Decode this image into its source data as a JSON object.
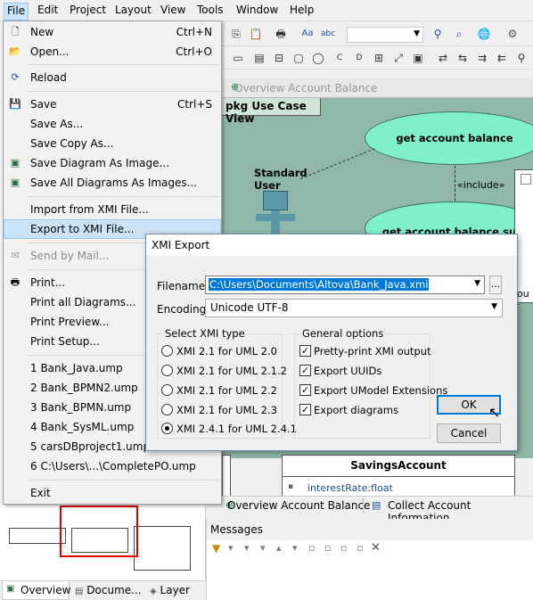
{
  "menubar": {
    "items": [
      "File",
      "Edit",
      "Project",
      "Layout",
      "View",
      "Tools",
      "Window",
      "Help"
    ]
  },
  "diagram": {
    "tab_title": "Overview Account Balance",
    "pkg_title": "pkg Use Case View",
    "actor_label_1": "Standard",
    "actor_label_2": "User",
    "usecase_1": "get account balance",
    "usecase_2": "get account balance sum",
    "include_label": "«include»",
    "savings_title": "SavingsAccount",
    "savings_attr": "interestRate:float",
    "right_fragment": "ou"
  },
  "file_menu": {
    "new": "New",
    "new_sc": "Ctrl+N",
    "open": "Open...",
    "open_sc": "Ctrl+O",
    "reload": "Reload",
    "save": "Save",
    "save_sc": "Ctrl+S",
    "save_as": "Save As...",
    "save_copy": "Save Copy As...",
    "save_diagram_image": "Save Diagram As Image...",
    "save_all_images": "Save All Diagrams As Images...",
    "import_xmi": "Import from XMI File...",
    "export_xmi": "Export to XMI File...",
    "send_mail": "Send by Mail...",
    "print": "Print...",
    "print_all": "Print all Diagrams...",
    "print_preview": "Print Preview...",
    "print_setup": "Print Setup...",
    "recent": [
      "1 Bank_Java.ump",
      "2 Bank_BPMN2.ump",
      "3 Bank_BPMN.ump",
      "4 Bank_SysML.ump",
      "5 carsDBproject1.ump",
      "6 C:\\Users\\...\\CompletePO.ump"
    ],
    "exit": "Exit"
  },
  "dialog": {
    "title": "XMI Export",
    "filename_label": "Filename:",
    "filename_value": "C:\\Users\\Documents\\Altova\\Bank_Java.xmi",
    "browse": "...",
    "encoding_label": "Encoding:",
    "encoding_value": "Unicode UTF-8",
    "xmi_group": "Select XMI type",
    "xmi_options": [
      "XMI 2.1 for UML 2.0",
      "XMI 2.1 for UML 2.1.2",
      "XMI 2.1 for UML 2.2",
      "XMI 2.1 for UML 2.3",
      "XMI 2.4.1 for UML 2.4.1"
    ],
    "xmi_selected": 4,
    "general_group": "General options",
    "general_options": [
      "Pretty-print XMI output",
      "Export UUIDs",
      "Export UModel Extensions",
      "Export diagrams"
    ],
    "ok": "OK",
    "cancel": "Cancel"
  },
  "bottom_tabs": {
    "tab1": "Overview Account Balance",
    "tab2": "Collect Account Information"
  },
  "messages": {
    "title": "Messages"
  },
  "left_tabs": {
    "overview": "Overview",
    "documentation": "Docume...",
    "layer": "Layer"
  },
  "colors": {
    "canvas": "#8fb8a8",
    "usecase": "#7ff0c8",
    "highlight": "#cce4f7",
    "accent": "#0078d7"
  }
}
